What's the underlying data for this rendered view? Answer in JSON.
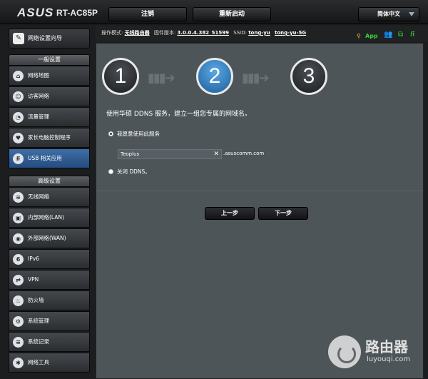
{
  "header": {
    "brand": "ASUS",
    "model": "RT-AC85P",
    "logout_label": "注销",
    "reboot_label": "重新启动",
    "language": "简体中文"
  },
  "status": {
    "mode_label": "操作模式:",
    "mode_value": "无线路由器",
    "firmware_label": "固件版本:",
    "firmware_value": "3.0.0.4.382_51599",
    "ssid_label": "SSID:",
    "ssid_1": "tong-yu",
    "ssid_2": "tong-yu-5G",
    "app_label": "App"
  },
  "sidebar": {
    "quick_setup": "网络设置向导",
    "general_header": "一般设置",
    "general_items": [
      {
        "label": "网络地图",
        "icon": "network-map-icon"
      },
      {
        "label": "访客网络",
        "icon": "guest-network-icon"
      },
      {
        "label": "流量管理",
        "icon": "traffic-manager-icon"
      },
      {
        "label": "家长电脑控制程序",
        "icon": "parental-control-icon"
      },
      {
        "label": "USB 相关应用",
        "icon": "usb-icon"
      }
    ],
    "advanced_header": "高级设置",
    "advanced_items": [
      {
        "label": "无线网络",
        "icon": "wireless-icon"
      },
      {
        "label": "内部网络(LAN)",
        "icon": "lan-icon"
      },
      {
        "label": "外部网络(WAN)",
        "icon": "wan-icon"
      },
      {
        "label": "IPv6",
        "icon": "ipv6-icon"
      },
      {
        "label": "VPN",
        "icon": "vpn-icon"
      },
      {
        "label": "防火墙",
        "icon": "firewall-icon"
      },
      {
        "label": "系统管理",
        "icon": "administration-icon"
      },
      {
        "label": "系统记录",
        "icon": "system-log-icon"
      },
      {
        "label": "网络工具",
        "icon": "network-tools-icon"
      }
    ]
  },
  "wizard": {
    "steps": [
      "1",
      "2",
      "3"
    ],
    "active_step": 2,
    "headline": "使用华硕 DDNS 服务，建立一组您专属的网域名。",
    "option_use": "我愿意使用此服务",
    "hostname_value": "Teoplus",
    "domain_suffix": ".asuscomm.com",
    "option_disable": "关闭 DDNS。",
    "prev_label": "上一步",
    "next_label": "下一步"
  },
  "watermark": {
    "title": "路由器",
    "url": "luyouqi.com"
  },
  "colors": {
    "active_nav": "#2f5d94",
    "active_step": "#2b7dc4",
    "panel_bg": "#4e5558",
    "app_green": "#3bd12f"
  }
}
